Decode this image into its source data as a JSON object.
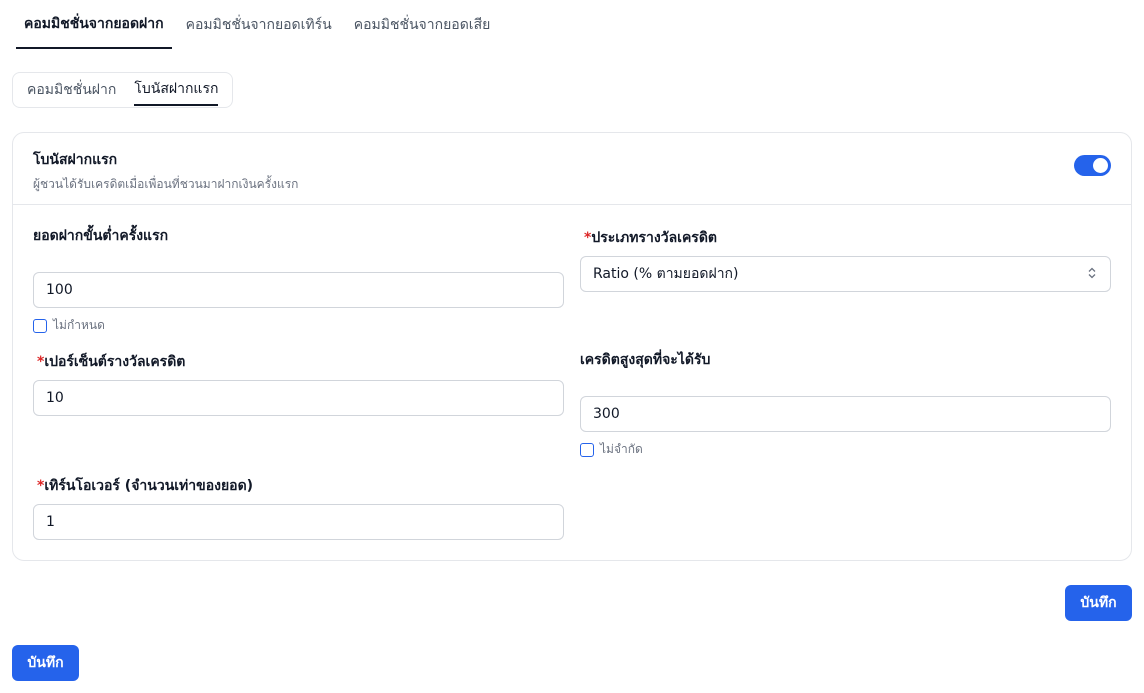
{
  "top_tabs": [
    {
      "label": "คอมมิชชั่นจากยอดฝาก"
    },
    {
      "label": "คอมมิชชั่นจากยอดเทิร์น"
    },
    {
      "label": "คอมมิชชั่นจากยอดเสีย"
    }
  ],
  "sub_tabs": [
    {
      "label": "คอมมิชชั่นฝาก"
    },
    {
      "label": "โบนัสฝากแรก"
    }
  ],
  "card": {
    "title": "โบนัสฝากแรก",
    "description": "ผู้ชวนได้รับเครดิตเมื่อเพื่อนที่ชวนมาฝากเงินครั้งแรก",
    "toggle_on": true
  },
  "fields": {
    "min_deposit": {
      "label": "ยอดฝากขั้นต่ำครั้งแรก",
      "value": "100",
      "checkbox_label": "ไม่กำหนด"
    },
    "reward_type": {
      "label": "ประเภทรางวัลเครดิต",
      "value": "Ratio (% ตามยอดฝาก)"
    },
    "percent": {
      "label": "เปอร์เซ็นต์รางวัลเครดิต",
      "value": "10"
    },
    "max_credit": {
      "label": "เครดิตสูงสุดที่จะได้รับ",
      "value": "300",
      "checkbox_label": "ไม่จำกัด"
    },
    "turnover": {
      "label": "เทิร์นโอเวอร์ (จำนวนเท่าของยอด)",
      "value": "1"
    }
  },
  "required_mark": "*",
  "buttons": {
    "save_inner": "บันทึก",
    "save_outer": "บันทึก"
  },
  "colors": {
    "accent": "#2563eb",
    "required": "#dc2626"
  }
}
